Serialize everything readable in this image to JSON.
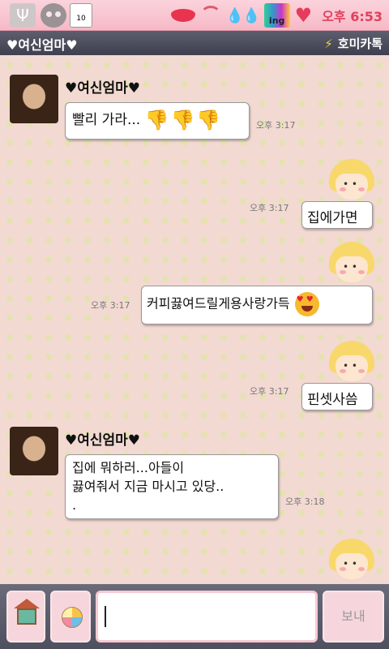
{
  "status_bar": {
    "clock": "오후 6:53",
    "icons": [
      "usb-icon",
      "skull-icon",
      "calendar-icon",
      "lips-icon",
      "wifi-icon",
      "water-drops-icon",
      "signal-ing-icon",
      "heart-icon"
    ],
    "calendar_day": "10"
  },
  "header": {
    "contact_name": "♥여신엄마♥",
    "brand": "호미카톡"
  },
  "messages": [
    {
      "side": "left",
      "sender": "♥여신엄마♥",
      "text": "빨리 가라...",
      "emoji": "👎👎👎",
      "time": "오후 3:17"
    },
    {
      "side": "right",
      "text": "집에가면",
      "time": "오후 3:17"
    },
    {
      "side": "right",
      "text": "커피끓여드릴게용사랑가득",
      "emoji": "heart-eyes",
      "time": "오후 3:17"
    },
    {
      "side": "right",
      "text": "핀셋사씀",
      "time": "오후 3:17"
    },
    {
      "side": "left",
      "sender": "♥여신엄마♥",
      "text_line1": "집에 뭐하러...아들이",
      "text_line2": "끓여줘서 지금 마시고 있당..",
      "text_line3": ".",
      "time": "오후 3:18"
    }
  ],
  "composer": {
    "send_label": "보내"
  },
  "colors": {
    "status_bar": "#f6b9c6",
    "title_bar": "#4b4c5a",
    "chat_background": "#f2d9d1",
    "dots": "#e3e3b0",
    "clock": "#e0405c"
  }
}
